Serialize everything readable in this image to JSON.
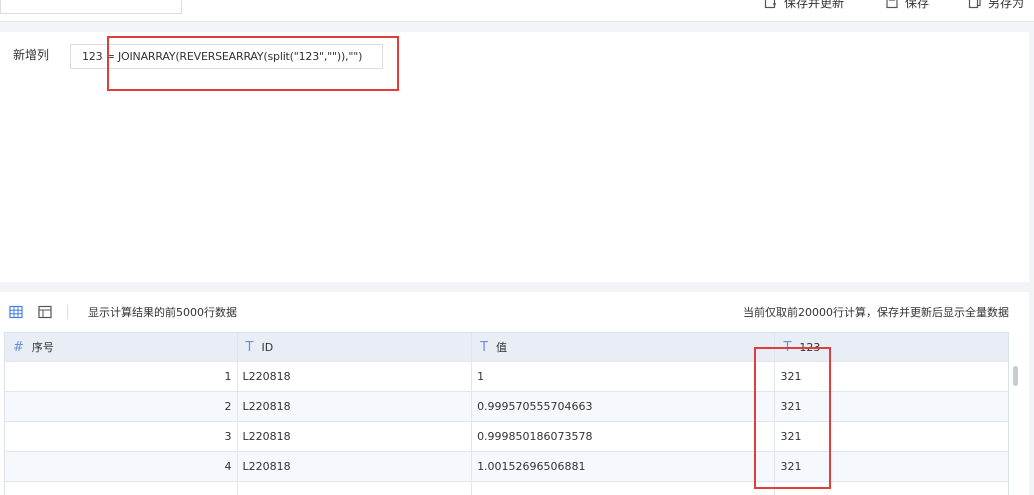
{
  "toolbar": {
    "save_and_update_label": "保存并更新",
    "save_label": "保存",
    "save_as_label": "另存为"
  },
  "formula": {
    "label": "新增列",
    "expression": "123 = JOINARRAY(REVERSEARRAY(split(\"123\",\"\")),\"\")"
  },
  "preview": {
    "note_left": "显示计算结果的前5000行数据",
    "note_right": "当前仅取前20000行计算，保存并更新后显示全量数据"
  },
  "grid": {
    "columns": [
      {
        "type_icon": "#",
        "label": "序号"
      },
      {
        "type_icon": "T",
        "label": "ID"
      },
      {
        "type_icon": "T",
        "label": "值"
      },
      {
        "type_icon": "T",
        "label": "123"
      }
    ],
    "rows": [
      {
        "seq": "1",
        "id": "L220818",
        "value": "1",
        "result": "321"
      },
      {
        "seq": "2",
        "id": "L220818",
        "value": "0.999570555704663",
        "result": "321"
      },
      {
        "seq": "3",
        "id": "L220818",
        "value": "0.999850186073578",
        "result": "321"
      },
      {
        "seq": "4",
        "id": "L220818",
        "value": "1.00152696506881",
        "result": "321"
      }
    ]
  },
  "colors": {
    "highlight": "#e03d3d",
    "header_bg": "#e9eef6",
    "icon_accent": "#6a90d8"
  }
}
